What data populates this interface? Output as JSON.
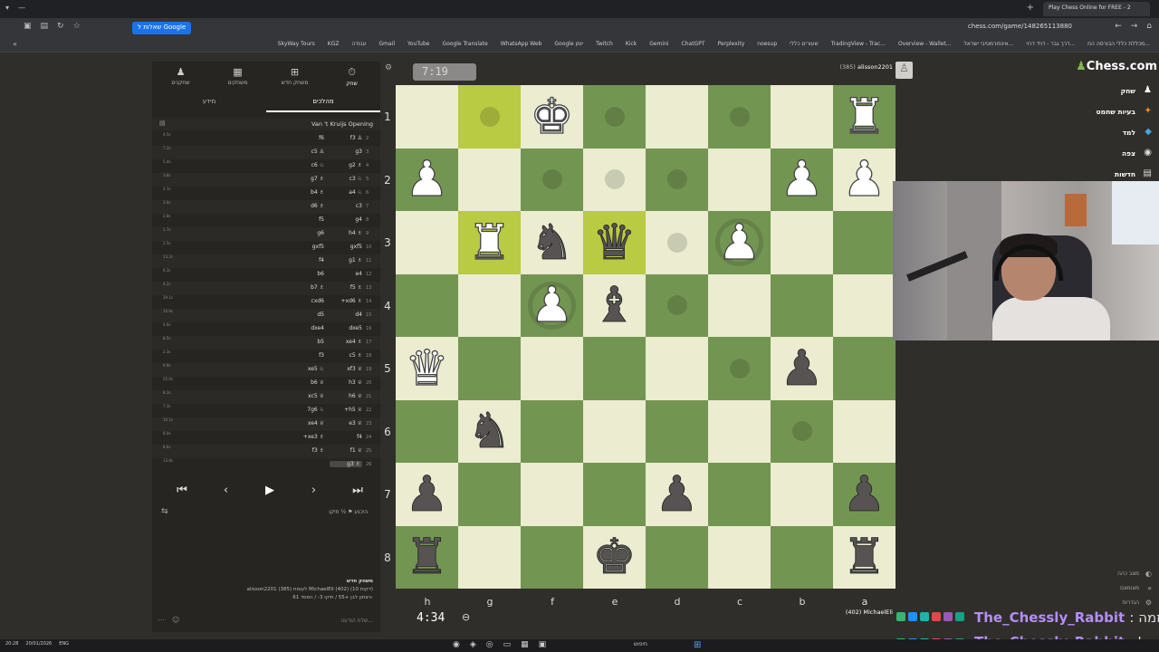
{
  "browser": {
    "active_tab": "Play Chess Online for FREE - 2",
    "url": "chess.com/game/148265113880",
    "search_chip": "שאלות ל Google",
    "bookmarks": [
      "SkyWay Tours",
      "KGZ",
      "עבודה",
      "Gmail",
      "YouTube",
      "Google Translate",
      "WhatsApp Web",
      "Google יומן",
      "Twitch",
      "Kick",
      "Gemini",
      "ChatGPT",
      "Perplexity",
      "noesup",
      "שעורים כללי",
      "TradingView - Trac...",
      "Overview - Wallet...",
      "אינפורמטיבי ישראל...",
      "דרך גבר - דויד דרוי...",
      "מכללת כללי הבורסה הח..."
    ]
  },
  "left_panel": {
    "nav": [
      {
        "label": "שחק",
        "icon": "stopwatch-icon"
      },
      {
        "label": "משחק חדש",
        "icon": "plus-icon"
      },
      {
        "label": "משחקים",
        "icon": "board-icon"
      },
      {
        "label": "שחקנים",
        "icon": "players-icon"
      }
    ],
    "subtabs": [
      "מהלכים",
      "מידע"
    ],
    "opening": "Van 't Kruijs Opening",
    "moves": [
      {
        "n": "2",
        "w": "f3 ♙",
        "b": "f6",
        "clk": "4.5s"
      },
      {
        "n": "3",
        "w": "g3",
        "b": "c5 ♙",
        "clk": "7.2s"
      },
      {
        "n": "4",
        "w": "g2 ♗",
        "b": "c6 ♘",
        "clk": "5.4s"
      },
      {
        "n": "5",
        "w": "c3 ♘",
        "b": "g7 ♗",
        "clk": "3.8s"
      },
      {
        "n": "6",
        "w": "a4 ♘",
        "b": "b4 ♗",
        "clk": "2.1s"
      },
      {
        "n": "7",
        "w": "c3",
        "b": "d6 ♗",
        "clk": "3.0s"
      },
      {
        "n": "8",
        "w": "g4",
        "b": "f5",
        "clk": "2.8s"
      },
      {
        "n": "9",
        "w": "h4 ♗",
        "b": "g6",
        "clk": "1.7s"
      },
      {
        "n": "10",
        "w": "gxf5",
        "b": "gxf5",
        "clk": "2.5s"
      },
      {
        "n": "11",
        "w": "g1 ♗",
        "b": "f4",
        "clk": "13.2s"
      },
      {
        "n": "12",
        "w": "e4",
        "b": "b6",
        "clk": "6.3s"
      },
      {
        "n": "13",
        "w": "f5 ♗",
        "b": "b7 ♗",
        "clk": "4.2s"
      },
      {
        "n": "14",
        "w": "+xd6 ♗",
        "b": "cxd6",
        "clk": "29.1s"
      },
      {
        "n": "15",
        "w": "d4",
        "b": "d5",
        "clk": "10.6s"
      },
      {
        "n": "16",
        "w": "dxe5",
        "b": "dxe4",
        "clk": "4.6s"
      },
      {
        "n": "17",
        "w": "xe4 ♗",
        "b": "b5",
        "clk": "8.5s"
      },
      {
        "n": "18",
        "w": "c5 ♗",
        "b": "f3",
        "clk": "2.3s"
      },
      {
        "n": "19",
        "w": "xf3 ♕",
        "b": "xe5 ♘",
        "clk": "9.9s"
      },
      {
        "n": "20",
        "w": "h3 ♕",
        "b": "b6 ♕",
        "clk": "25.0s"
      },
      {
        "n": "21",
        "w": "h6 ♕",
        "b": "xc5 ♕",
        "clk": "8.1s"
      },
      {
        "n": "22",
        "w": "+h5 ♕",
        "b": "7g6 ♘",
        "clk": "7.3s"
      },
      {
        "n": "23",
        "w": "e3 ♕",
        "b": "xe4 ♕",
        "clk": "10.1s"
      },
      {
        "n": "24",
        "w": "f4",
        "b": "+xe3 ♗",
        "clk": "8.0s"
      },
      {
        "n": "25",
        "w": "f1 ♕",
        "b": "f3 ♗",
        "clk": "8.6s"
      },
      {
        "n": "26",
        "w": "g3 ♗",
        "b": "",
        "clk": "13.8s"
      }
    ],
    "controls": [
      "first-move",
      "previous-move",
      "play",
      "next-move",
      "last-move"
    ],
    "options": {
      "draw": "½ תיקו",
      "resign": "היכנע"
    },
    "game_info": {
      "title": "משחק חדש",
      "line1": "alisson2201 (385) לעומת MichaelEli (402) (10 דקות)",
      "line2": "ניצחון לבן +55 / תיקו 3- / הפסד 61-"
    },
    "chat_placeholder": "שלח הודעה..."
  },
  "board": {
    "top_clock": "7:19",
    "bottom_clock": "4:34",
    "top_player": {
      "name": "alisson2201",
      "rating": "(385)"
    },
    "bottom_player": {
      "name": "MichaelEli",
      "rating": "(402)"
    },
    "ranks": [
      "1",
      "2",
      "3",
      "4",
      "5",
      "6",
      "7",
      "8"
    ],
    "files": [
      "h",
      "g",
      "f",
      "e",
      "d",
      "c",
      "b",
      "a"
    ],
    "squares": [
      [
        "",
        "",
        "wK",
        "",
        "",
        "",
        "",
        "wR"
      ],
      [
        "wP",
        "",
        "",
        "",
        "",
        "",
        "wP",
        "wP"
      ],
      [
        "",
        "wR",
        "bN",
        "bQ",
        "",
        "wP",
        "",
        ""
      ],
      [
        "",
        "",
        "wP",
        "bB",
        "",
        "",
        "",
        ""
      ],
      [
        "wQ",
        "",
        "",
        "",
        "",
        "",
        "bP",
        ""
      ],
      [
        "",
        "bN",
        "",
        "",
        "",
        "",
        "",
        ""
      ],
      [
        "bP",
        "",
        "",
        "",
        "bP",
        "",
        "",
        "bP"
      ],
      [
        "bR",
        "",
        "",
        "bK",
        "",
        "",
        "",
        "bR"
      ]
    ],
    "highlights": [
      [
        0,
        1
      ],
      [
        2,
        1
      ],
      [
        2,
        3
      ]
    ],
    "dots": [
      [
        0,
        1
      ],
      [
        0,
        3
      ],
      [
        0,
        5
      ],
      [
        1,
        2
      ],
      [
        1,
        3
      ],
      [
        1,
        4
      ],
      [
        2,
        4
      ],
      [
        3,
        4
      ],
      [
        4,
        5
      ],
      [
        5,
        6
      ]
    ],
    "rings": [
      [
        2,
        5
      ],
      [
        3,
        2
      ]
    ]
  },
  "sidebar": {
    "logo": "Chess.com",
    "items": [
      {
        "label": "שחק",
        "icon": "pawn-icon"
      },
      {
        "label": "בעיות שחמט",
        "icon": "puzzle-icon"
      },
      {
        "label": "למד",
        "icon": "learn-icon"
      },
      {
        "label": "צפה",
        "icon": "watch-icon"
      },
      {
        "label": "חדשות",
        "icon": "news-icon"
      }
    ],
    "bottom": [
      "מצב כהה",
      "מצומצם",
      "הגדרות"
    ]
  },
  "stream": {
    "name": "The_Chessly_Rabbit",
    "tail1": ": יוזמה",
    "tail2": ": יתייל"
  },
  "taskbar": {
    "time": "20:28",
    "date": "20/01/2026",
    "lang": "ENG",
    "search": "חיפוש"
  },
  "colors": {
    "light": "#ebecd0",
    "dark": "#739552",
    "hl_light": "#f5f682",
    "hl_dark": "#b9ca43",
    "stream_name": "#b48ef5"
  }
}
